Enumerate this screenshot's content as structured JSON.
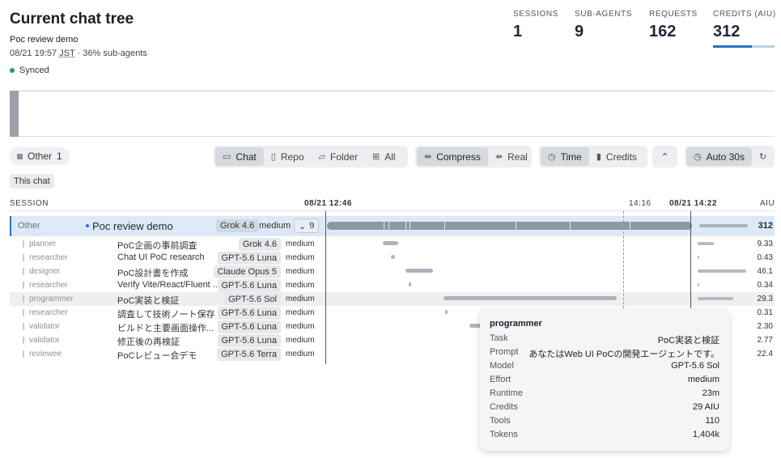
{
  "header": {
    "title": "Current chat tree",
    "subtitle": "Poc review demo",
    "timestamp": "08/21 19:57",
    "timezone": "JST",
    "meta_suffix": " · 36% sub-agents",
    "sync_status": "Synced"
  },
  "stats": [
    {
      "label": "SESSIONS",
      "value": "1"
    },
    {
      "label": "SUB-AGENTS",
      "value": "9"
    },
    {
      "label": "REQUESTS",
      "value": "162"
    },
    {
      "label": "CREDITS (AIU)",
      "value": "312"
    }
  ],
  "credits_progress_fraction": 0.63,
  "filter_chip": {
    "label": "Other",
    "count": "1"
  },
  "toolbar": {
    "scope": {
      "chat": "Chat",
      "repo": "Repo",
      "folder": "Folder",
      "all": "All"
    },
    "layout": {
      "compress": "Compress",
      "real": "Real"
    },
    "metric": {
      "time": "Time",
      "credits": "Credits"
    },
    "collapse_icon": "chevron-up-icon",
    "auto_refresh": "Auto 30s",
    "refresh_icon": "refresh-icon"
  },
  "this_chat_label": "This chat",
  "columns": {
    "session": "SESSION",
    "time_start": "08/21 12:46",
    "time_mid": "14:16",
    "time_end": "08/21 14:22",
    "aiu": "AIU"
  },
  "main_session": {
    "category": "Other",
    "name": "Poc review demo",
    "model": "Grok 4.6",
    "effort": "medium",
    "children_count": "9",
    "aiu": "312"
  },
  "agents": [
    {
      "role": "planner",
      "task": "PoC企画の事前調査",
      "model": "Grok 4.6",
      "effort": "medium",
      "aiu": "9.33"
    },
    {
      "role": "researcher",
      "task": "Chat UI PoC research",
      "model": "GPT-5.6 Luna",
      "effort": "medium",
      "aiu": "0.43"
    },
    {
      "role": "designer",
      "task": "PoC設計書を作成",
      "model": "Claude Opus 5",
      "effort": "medium",
      "aiu": "46.1"
    },
    {
      "role": "researcher",
      "task": "Verify Vite/React/Fluent ...",
      "model": "GPT-5.6 Luna",
      "effort": "medium",
      "aiu": "0.34"
    },
    {
      "role": "programmer",
      "task": "PoC実装と検証",
      "model": "GPT-5.6 Sol",
      "effort": "medium",
      "aiu": "29.3"
    },
    {
      "role": "researcher",
      "task": "調査して技術ノート保存",
      "model": "GPT-5.6 Luna",
      "effort": "medium",
      "aiu": "0.31"
    },
    {
      "role": "validator",
      "task": "ビルドと主要画面操作...",
      "model": "GPT-5.6 Luna",
      "effort": "medium",
      "aiu": "2.30"
    },
    {
      "role": "validator",
      "task": "修正後の再検証",
      "model": "GPT-5.6 Luna",
      "effort": "medium",
      "aiu": "2.77"
    },
    {
      "role": "reviewee",
      "task": "PoCレビュー会デモ",
      "model": "GPT-5.6 Terra",
      "effort": "medium",
      "aiu": "22.4"
    }
  ],
  "tooltip": {
    "title": "programmer",
    "rows": [
      {
        "key": "Task",
        "value": "PoC実装と検証"
      },
      {
        "key": "Prompt",
        "value": "あなたはWeb UI PoCの開発エージェントです。"
      },
      {
        "key": "Model",
        "value": "GPT-5.6 Sol"
      },
      {
        "key": "Effort",
        "value": "medium"
      },
      {
        "key": "Runtime",
        "value": "23m"
      },
      {
        "key": "Credits",
        "value": "29 AIU"
      },
      {
        "key": "Tools",
        "value": "110"
      },
      {
        "key": "Tokens",
        "value": "1,404k"
      }
    ]
  }
}
